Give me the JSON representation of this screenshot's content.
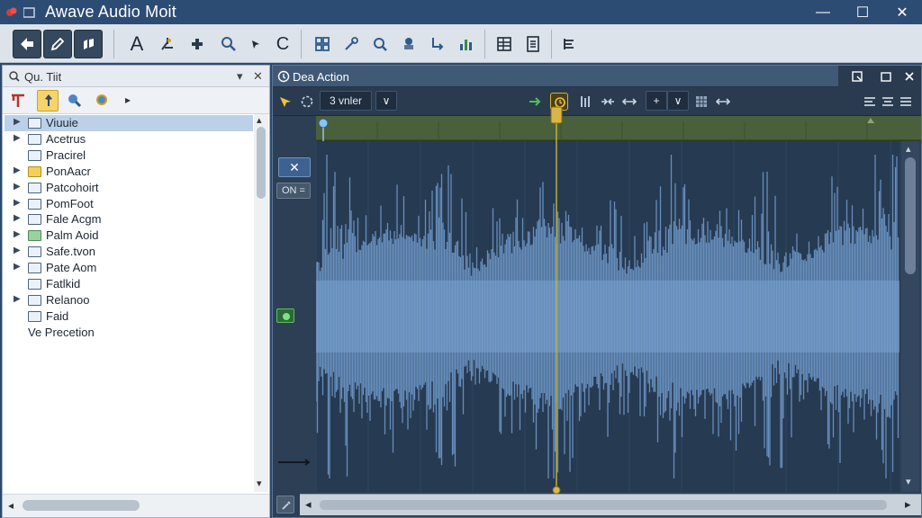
{
  "window": {
    "title": "Awave Audio  Moit",
    "minimize_glyph": "—",
    "maximize_glyph": "☐",
    "close_glyph": "✕"
  },
  "toolbar": {
    "text_tool_label": "A",
    "c_tool_label": "C"
  },
  "left_panel": {
    "header_label": "Qu. Tiit",
    "dropdown_glyph": "▾",
    "close_glyph": "✕",
    "more_glyph": "▸",
    "tree": [
      {
        "label": "Viuuie",
        "expandable": true,
        "folder": "plain",
        "selected": true
      },
      {
        "label": "Acetrus",
        "expandable": true,
        "folder": "plain",
        "selected": false
      },
      {
        "label": "Pracirel",
        "expandable": false,
        "folder": "plain",
        "selected": false
      },
      {
        "label": "PonAacr",
        "expandable": true,
        "folder": "yellow",
        "selected": false
      },
      {
        "label": "Patcohoirt",
        "expandable": true,
        "folder": "plain",
        "selected": false
      },
      {
        "label": "PomFoot",
        "expandable": true,
        "folder": "plain",
        "selected": false
      },
      {
        "label": "Fale Acgm",
        "expandable": true,
        "folder": "plain",
        "selected": false
      },
      {
        "label": "Palm Aoid",
        "expandable": true,
        "folder": "green",
        "selected": false
      },
      {
        "label": "Safe.tvon",
        "expandable": true,
        "folder": "plain",
        "selected": false
      },
      {
        "label": "Pate Aom",
        "expandable": true,
        "folder": "plain",
        "selected": false
      },
      {
        "label": "Fatlkid",
        "expandable": false,
        "folder": "plain",
        "selected": false
      },
      {
        "label": "Relanoo",
        "expandable": true,
        "folder": "plain",
        "selected": false
      },
      {
        "label": "Faid",
        "expandable": false,
        "folder": "plain",
        "selected": false
      },
      {
        "label": "Ve Precetion",
        "expandable": false,
        "folder": "none",
        "selected": false
      }
    ]
  },
  "editor": {
    "header_label": "Dea Action",
    "dropdown_value": "3 vnler",
    "dropdown_chevron": "∨",
    "plus_label": "+",
    "small_chevron": "∨",
    "gutter_close": "✕",
    "gutter_label": "ON =",
    "scroll_left": "◂",
    "scroll_right": "▸",
    "scroll_up": "▴",
    "scroll_down": "▾"
  },
  "colors": {
    "titlebar": "#2d4c74",
    "waveform": "#6f98c8",
    "waveform_bg": "#263a52",
    "playhead": "#c9b73a",
    "ruler": "#4a5f3c"
  }
}
